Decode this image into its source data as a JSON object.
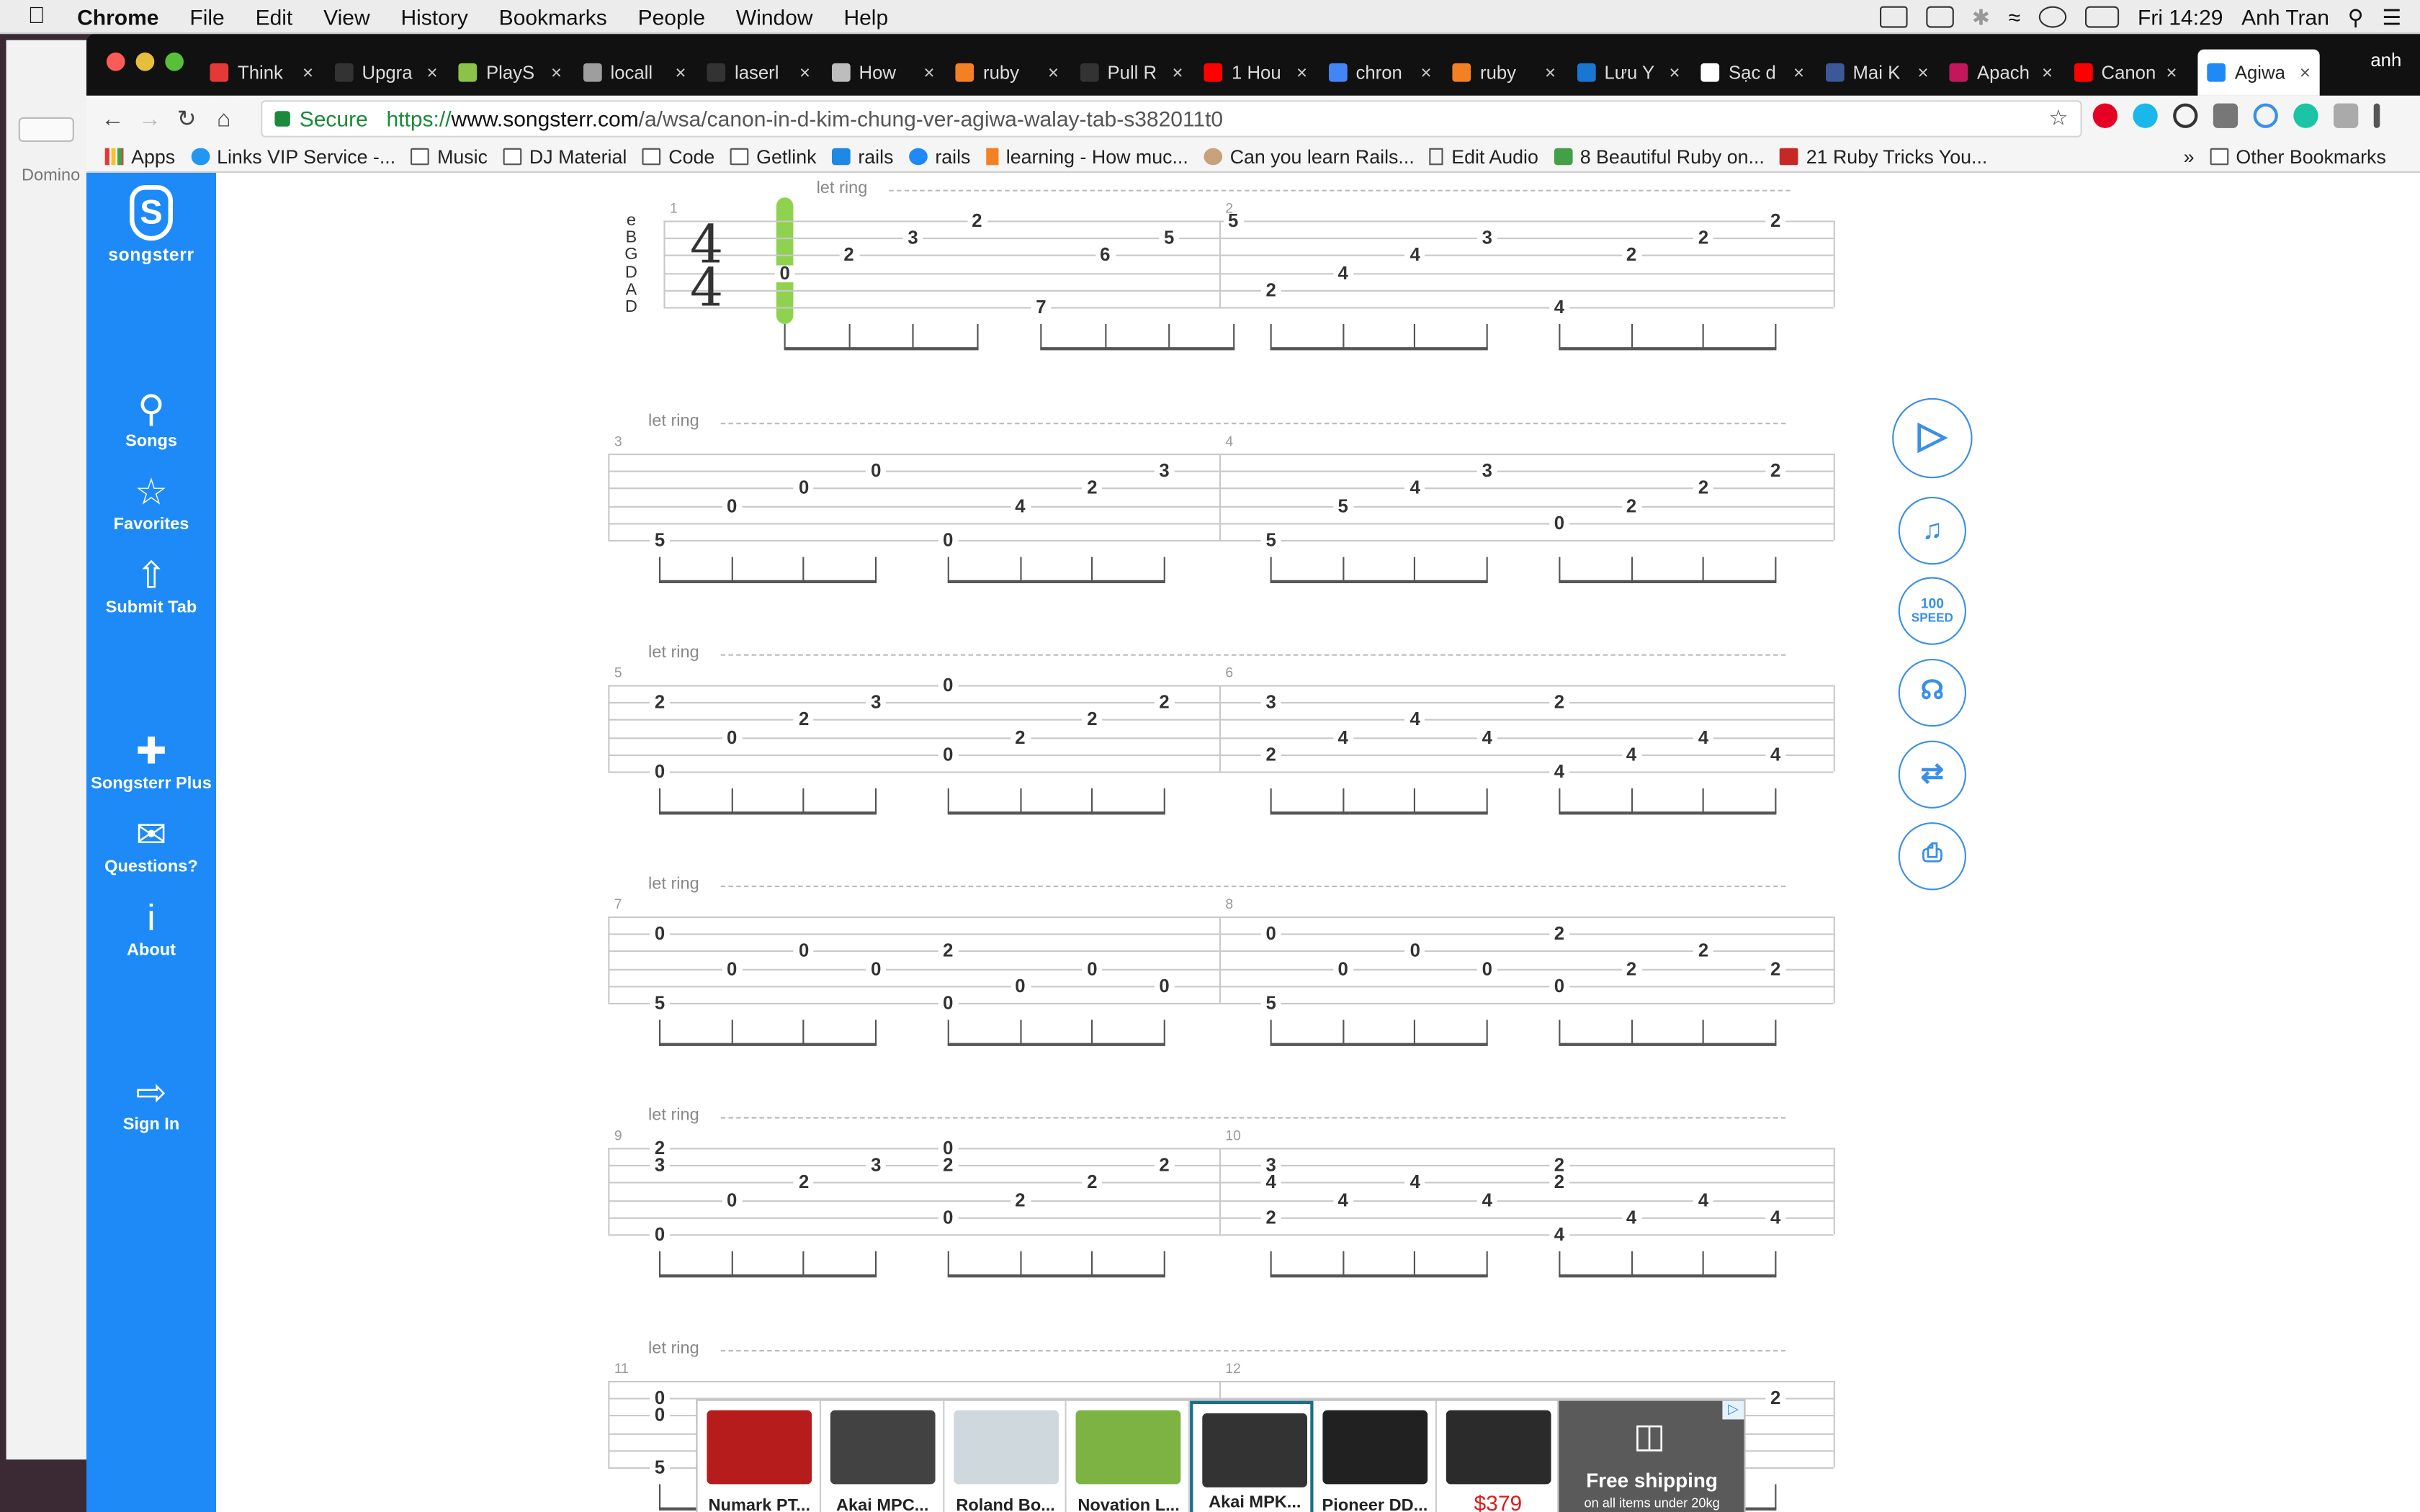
{
  "menubar": {
    "app": "Chrome",
    "items": [
      "File",
      "Edit",
      "View",
      "History",
      "Bookmarks",
      "People",
      "Window",
      "Help"
    ],
    "clock": "Fri 14:29",
    "user": "Anh Tran"
  },
  "background_window": {
    "label": "Domino"
  },
  "tabs": [
    {
      "title": "Think",
      "color": "#e53935"
    },
    {
      "title": "Upgra",
      "color": "#333333"
    },
    {
      "title": "PlayS",
      "color": "#8bc34a"
    },
    {
      "title": "locall",
      "color": "#9e9e9e"
    },
    {
      "title": "laserl",
      "color": "#333333"
    },
    {
      "title": "How",
      "color": "#bdbdbd"
    },
    {
      "title": "ruby",
      "color": "#f48024"
    },
    {
      "title": "Pull R",
      "color": "#333333"
    },
    {
      "title": "1 Hou",
      "color": "#ff0000"
    },
    {
      "title": "chron",
      "color": "#4285f4"
    },
    {
      "title": "ruby",
      "color": "#f48024"
    },
    {
      "title": "Lưu Y",
      "color": "#1976d2"
    },
    {
      "title": "Sạc d",
      "color": "#ffffff"
    },
    {
      "title": "Mai K",
      "color": "#3b5998"
    },
    {
      "title": "Apach",
      "color": "#c2185b"
    },
    {
      "title": "Canon",
      "color": "#ff0000"
    },
    {
      "title": "Agiwa",
      "color": "#1d8af7"
    }
  ],
  "profile": "anh",
  "omnibox": {
    "secure": "Secure",
    "url_prefix": "https://",
    "url_host": "www.songsterr.com",
    "url_path": "/a/wsa/canon-in-d-kim-chung-ver-agiwa-walay-tab-s382011t0"
  },
  "bookmarks": [
    "Apps",
    "Links VIP Service -...",
    "Music",
    "DJ Material",
    "Code",
    "Getlink",
    "rails",
    "rails",
    "learning - How muc...",
    "Can you learn Rails...",
    "Edit Audio",
    "8 Beautiful Ruby on...",
    "21 Ruby Tricks You..."
  ],
  "bookmarks_other": "Other Bookmarks",
  "sidebar": {
    "logo": "songsterr",
    "items": [
      {
        "label": "Songs",
        "icon": "search-icon"
      },
      {
        "label": "Favorites",
        "icon": "star-icon"
      },
      {
        "label": "Submit Tab",
        "icon": "upload-icon"
      },
      {
        "label": "Songsterr Plus",
        "icon": "plus-icon"
      },
      {
        "label": "Questions?",
        "icon": "mail-question-icon"
      },
      {
        "label": "About",
        "icon": "info-icon"
      },
      {
        "label": "Sign In",
        "icon": "sign-in-icon"
      }
    ]
  },
  "tab": {
    "let_ring": "let ring",
    "tuning": [
      "e",
      "B",
      "G",
      "D",
      "A",
      "D"
    ],
    "time_signature": [
      "4",
      "4"
    ],
    "measures": [
      {
        "n": "1",
        "notes": [
          [
            0,
            3,
            "0"
          ],
          [
            1,
            2,
            "2"
          ],
          [
            2,
            1,
            "3"
          ],
          [
            3,
            0,
            "2"
          ],
          [
            4,
            5,
            "7"
          ],
          [
            5,
            2,
            "6"
          ],
          [
            6,
            1,
            "5"
          ],
          [
            7,
            0,
            "5"
          ]
        ]
      },
      {
        "n": "2",
        "notes": [
          [
            0,
            4,
            "2"
          ],
          [
            1,
            3,
            "4"
          ],
          [
            2,
            2,
            "4"
          ],
          [
            3,
            1,
            "3"
          ],
          [
            4,
            5,
            "4"
          ],
          [
            5,
            2,
            "2"
          ],
          [
            6,
            1,
            "2"
          ],
          [
            7,
            0,
            "2"
          ]
        ]
      },
      {
        "n": "3",
        "notes": [
          [
            0,
            5,
            "5"
          ],
          [
            1,
            3,
            "0"
          ],
          [
            2,
            2,
            "0"
          ],
          [
            3,
            1,
            "0"
          ],
          [
            4,
            5,
            "0"
          ],
          [
            5,
            3,
            "4"
          ],
          [
            6,
            2,
            "2"
          ],
          [
            7,
            1,
            "3"
          ]
        ]
      },
      {
        "n": "4",
        "notes": [
          [
            0,
            5,
            "5"
          ],
          [
            1,
            3,
            "5"
          ],
          [
            2,
            2,
            "4"
          ],
          [
            3,
            1,
            "3"
          ],
          [
            4,
            4,
            "0"
          ],
          [
            5,
            3,
            "2"
          ],
          [
            6,
            2,
            "2"
          ],
          [
            7,
            1,
            "2"
          ]
        ]
      },
      {
        "n": "5",
        "notes": [
          [
            0,
            1,
            "2"
          ],
          [
            0,
            5,
            "0"
          ],
          [
            1,
            3,
            "0"
          ],
          [
            2,
            2,
            "2"
          ],
          [
            3,
            1,
            "3"
          ],
          [
            4,
            0,
            "0"
          ],
          [
            4,
            4,
            "0"
          ],
          [
            5,
            3,
            "2"
          ],
          [
            6,
            2,
            "2"
          ],
          [
            7,
            1,
            "2"
          ]
        ]
      },
      {
        "n": "6",
        "notes": [
          [
            0,
            1,
            "3"
          ],
          [
            0,
            4,
            "2"
          ],
          [
            1,
            3,
            "4"
          ],
          [
            2,
            2,
            "4"
          ],
          [
            3,
            3,
            "4"
          ],
          [
            4,
            1,
            "2"
          ],
          [
            4,
            5,
            "4"
          ],
          [
            5,
            4,
            "4"
          ],
          [
            6,
            3,
            "4"
          ],
          [
            7,
            4,
            "4"
          ]
        ]
      },
      {
        "n": "7",
        "notes": [
          [
            0,
            1,
            "0"
          ],
          [
            0,
            5,
            "5"
          ],
          [
            1,
            3,
            "0"
          ],
          [
            2,
            2,
            "0"
          ],
          [
            3,
            3,
            "0"
          ],
          [
            4,
            2,
            "2"
          ],
          [
            4,
            5,
            "0"
          ],
          [
            5,
            4,
            "0"
          ],
          [
            6,
            3,
            "0"
          ],
          [
            7,
            4,
            "0"
          ]
        ]
      },
      {
        "n": "8",
        "notes": [
          [
            0,
            1,
            "0"
          ],
          [
            0,
            5,
            "5"
          ],
          [
            1,
            3,
            "0"
          ],
          [
            2,
            2,
            "0"
          ],
          [
            3,
            3,
            "0"
          ],
          [
            4,
            1,
            "2"
          ],
          [
            4,
            4,
            "0"
          ],
          [
            5,
            3,
            "2"
          ],
          [
            6,
            2,
            "2"
          ],
          [
            7,
            3,
            "2"
          ]
        ]
      },
      {
        "n": "9",
        "notes": [
          [
            0,
            0,
            "2"
          ],
          [
            0,
            1,
            "3"
          ],
          [
            0,
            5,
            "0"
          ],
          [
            1,
            3,
            "0"
          ],
          [
            2,
            2,
            "2"
          ],
          [
            3,
            1,
            "3"
          ],
          [
            4,
            0,
            "0"
          ],
          [
            4,
            1,
            "2"
          ],
          [
            4,
            4,
            "0"
          ],
          [
            5,
            3,
            "2"
          ],
          [
            6,
            2,
            "2"
          ],
          [
            7,
            1,
            "2"
          ]
        ]
      },
      {
        "n": "10",
        "notes": [
          [
            0,
            1,
            "3"
          ],
          [
            0,
            2,
            "4"
          ],
          [
            0,
            4,
            "2"
          ],
          [
            1,
            3,
            "4"
          ],
          [
            2,
            2,
            "4"
          ],
          [
            3,
            3,
            "4"
          ],
          [
            4,
            1,
            "2"
          ],
          [
            4,
            2,
            "2"
          ],
          [
            4,
            5,
            "4"
          ],
          [
            5,
            4,
            "4"
          ],
          [
            6,
            3,
            "4"
          ],
          [
            7,
            4,
            "4"
          ]
        ]
      },
      {
        "n": "11",
        "notes": [
          [
            0,
            1,
            "0"
          ],
          [
            0,
            2,
            "0"
          ],
          [
            0,
            5,
            "5"
          ]
        ]
      },
      {
        "n": "12",
        "notes": [
          [
            7,
            1,
            "2"
          ]
        ]
      }
    ]
  },
  "controls": {
    "speed_value": "100",
    "speed_label": "SPEED"
  },
  "ad": {
    "items": [
      "Numark PT...",
      "Akai MPC...",
      "Roland Bo...",
      "Novation L...",
      "Akai MPK...",
      "Pioneer DD...",
      "$379"
    ],
    "shipping_title": "Free shipping",
    "shipping_sub": "on all items under 20kg",
    "badge": "▷"
  }
}
